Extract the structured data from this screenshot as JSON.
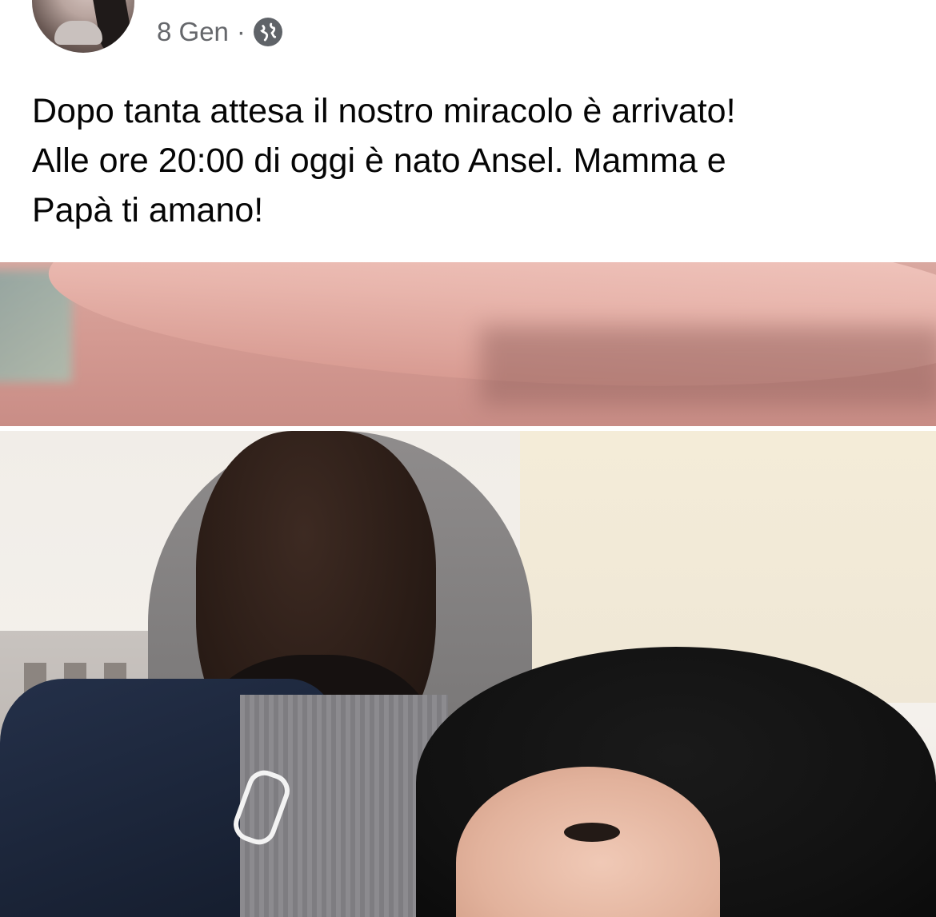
{
  "post": {
    "timestamp": "8 Gen",
    "separator": "·",
    "privacy_icon": "globe-icon",
    "text_lines": [
      "Dopo tanta attesa il nostro miracolo è arrivato!",
      "Alle ore 20:00 di oggi è nato Ansel. Mamma e",
      "Papà ti amano!"
    ]
  },
  "colors": {
    "text_primary": "#050505",
    "text_secondary": "#65676b",
    "background": "#ffffff"
  }
}
